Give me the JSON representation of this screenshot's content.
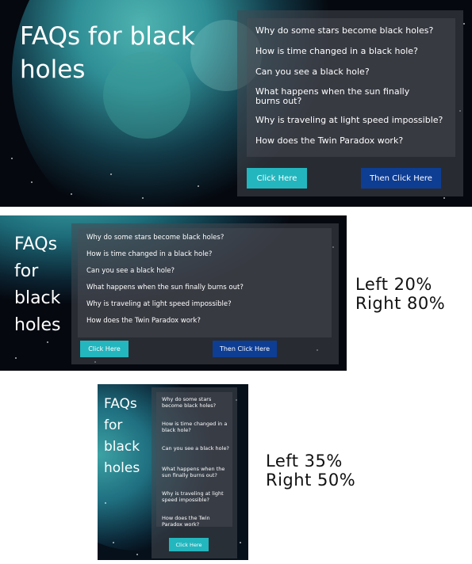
{
  "colors": {
    "teal_button": "#23b6be",
    "blue_button": "#0e3d94",
    "background": "#05080f"
  },
  "banners": [
    {
      "title": "FAQs for black holes",
      "questions": [
        "Why do some stars become black holes?",
        "How is time changed in a black hole?",
        "Can you see a black hole?",
        "What happens when the sun finally burns out?",
        "Why is traveling at light speed impossible?",
        "How does the Twin Paradox work?"
      ],
      "buttons": [
        "Click Here",
        "Then Click Here"
      ]
    },
    {
      "title": "FAQs for black holes",
      "questions": [
        "Why do some stars become black holes?",
        "How is time changed in a black hole?",
        "Can you see a black hole?",
        "What happens when the sun finally burns out?",
        "Why is traveling at light speed impossible?",
        "How does the Twin Paradox work?"
      ],
      "buttons": [
        "Click Here",
        "Then Click Here"
      ],
      "caption": [
        "Left 20%",
        "Right 80%"
      ]
    },
    {
      "title": "FAQs for black holes",
      "questions": [
        "Why do some stars become black holes?",
        "How is time changed in a black hole?",
        "Can you see a black hole?",
        "What happens when the sun finally burns out?",
        "Why is traveling at light speed impossible?",
        "How does the Twin Paradox work?"
      ],
      "buttons": [
        "Click Here"
      ],
      "caption": [
        "Left 35%",
        "Right 50%"
      ]
    }
  ]
}
